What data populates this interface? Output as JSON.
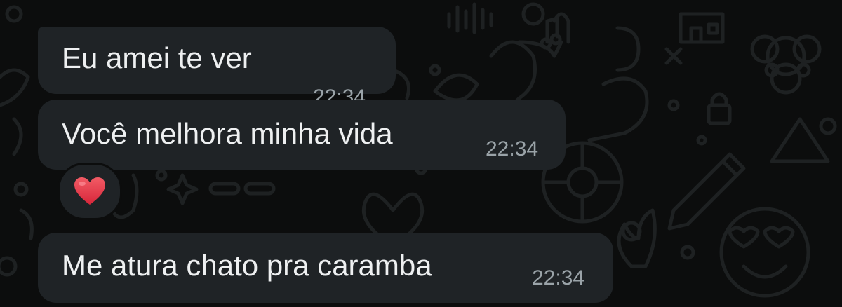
{
  "messages": [
    {
      "text": "Eu amei te ver",
      "time": "22:34"
    },
    {
      "text": "Você melhora minha vida",
      "time": "22:34"
    },
    {
      "text": "Me atura chato pra caramba",
      "time": "22:34"
    }
  ],
  "reaction": {
    "emoji": "heart-emoji",
    "color": "#e53945"
  },
  "colors": {
    "background": "#0c0d0d",
    "bubble": "#1f2326",
    "text": "#eef0f1",
    "time": "#9aa3a8",
    "doodle": "#1c1e1f"
  }
}
